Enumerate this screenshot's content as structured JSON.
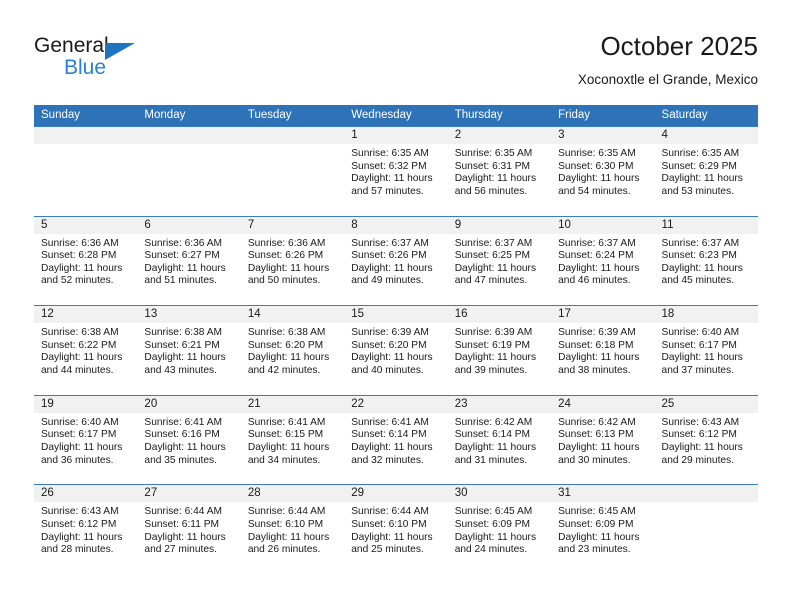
{
  "logo": {
    "text_primary": "General",
    "text_secondary": "Blue",
    "primary_color": "#1a1a1a",
    "secondary_color": "#2980d4",
    "triangle_color": "#1f74bd"
  },
  "header": {
    "title": "October 2025",
    "subtitle": "Xoconoxtle el Grande, Mexico"
  },
  "theme": {
    "header_bar_color": "#2e72b8",
    "date_band_color": "#f1f1f1",
    "week_divider_color": "#3b7cc0",
    "text_color": "#1a1a1a"
  },
  "calendar": {
    "day_headers": [
      "Sunday",
      "Monday",
      "Tuesday",
      "Wednesday",
      "Thursday",
      "Friday",
      "Saturday"
    ],
    "weeks": [
      [
        {
          "date": "",
          "empty": true
        },
        {
          "date": "",
          "empty": true
        },
        {
          "date": "",
          "empty": true
        },
        {
          "date": "1",
          "sunrise": "Sunrise: 6:35 AM",
          "sunset": "Sunset: 6:32 PM",
          "daylight": "Daylight: 11 hours and 57 minutes."
        },
        {
          "date": "2",
          "sunrise": "Sunrise: 6:35 AM",
          "sunset": "Sunset: 6:31 PM",
          "daylight": "Daylight: 11 hours and 56 minutes."
        },
        {
          "date": "3",
          "sunrise": "Sunrise: 6:35 AM",
          "sunset": "Sunset: 6:30 PM",
          "daylight": "Daylight: 11 hours and 54 minutes."
        },
        {
          "date": "4",
          "sunrise": "Sunrise: 6:35 AM",
          "sunset": "Sunset: 6:29 PM",
          "daylight": "Daylight: 11 hours and 53 minutes."
        }
      ],
      [
        {
          "date": "5",
          "sunrise": "Sunrise: 6:36 AM",
          "sunset": "Sunset: 6:28 PM",
          "daylight": "Daylight: 11 hours and 52 minutes."
        },
        {
          "date": "6",
          "sunrise": "Sunrise: 6:36 AM",
          "sunset": "Sunset: 6:27 PM",
          "daylight": "Daylight: 11 hours and 51 minutes."
        },
        {
          "date": "7",
          "sunrise": "Sunrise: 6:36 AM",
          "sunset": "Sunset: 6:26 PM",
          "daylight": "Daylight: 11 hours and 50 minutes."
        },
        {
          "date": "8",
          "sunrise": "Sunrise: 6:37 AM",
          "sunset": "Sunset: 6:26 PM",
          "daylight": "Daylight: 11 hours and 49 minutes."
        },
        {
          "date": "9",
          "sunrise": "Sunrise: 6:37 AM",
          "sunset": "Sunset: 6:25 PM",
          "daylight": "Daylight: 11 hours and 47 minutes."
        },
        {
          "date": "10",
          "sunrise": "Sunrise: 6:37 AM",
          "sunset": "Sunset: 6:24 PM",
          "daylight": "Daylight: 11 hours and 46 minutes."
        },
        {
          "date": "11",
          "sunrise": "Sunrise: 6:37 AM",
          "sunset": "Sunset: 6:23 PM",
          "daylight": "Daylight: 11 hours and 45 minutes."
        }
      ],
      [
        {
          "date": "12",
          "sunrise": "Sunrise: 6:38 AM",
          "sunset": "Sunset: 6:22 PM",
          "daylight": "Daylight: 11 hours and 44 minutes."
        },
        {
          "date": "13",
          "sunrise": "Sunrise: 6:38 AM",
          "sunset": "Sunset: 6:21 PM",
          "daylight": "Daylight: 11 hours and 43 minutes."
        },
        {
          "date": "14",
          "sunrise": "Sunrise: 6:38 AM",
          "sunset": "Sunset: 6:20 PM",
          "daylight": "Daylight: 11 hours and 42 minutes."
        },
        {
          "date": "15",
          "sunrise": "Sunrise: 6:39 AM",
          "sunset": "Sunset: 6:20 PM",
          "daylight": "Daylight: 11 hours and 40 minutes."
        },
        {
          "date": "16",
          "sunrise": "Sunrise: 6:39 AM",
          "sunset": "Sunset: 6:19 PM",
          "daylight": "Daylight: 11 hours and 39 minutes."
        },
        {
          "date": "17",
          "sunrise": "Sunrise: 6:39 AM",
          "sunset": "Sunset: 6:18 PM",
          "daylight": "Daylight: 11 hours and 38 minutes."
        },
        {
          "date": "18",
          "sunrise": "Sunrise: 6:40 AM",
          "sunset": "Sunset: 6:17 PM",
          "daylight": "Daylight: 11 hours and 37 minutes."
        }
      ],
      [
        {
          "date": "19",
          "sunrise": "Sunrise: 6:40 AM",
          "sunset": "Sunset: 6:17 PM",
          "daylight": "Daylight: 11 hours and 36 minutes."
        },
        {
          "date": "20",
          "sunrise": "Sunrise: 6:41 AM",
          "sunset": "Sunset: 6:16 PM",
          "daylight": "Daylight: 11 hours and 35 minutes."
        },
        {
          "date": "21",
          "sunrise": "Sunrise: 6:41 AM",
          "sunset": "Sunset: 6:15 PM",
          "daylight": "Daylight: 11 hours and 34 minutes."
        },
        {
          "date": "22",
          "sunrise": "Sunrise: 6:41 AM",
          "sunset": "Sunset: 6:14 PM",
          "daylight": "Daylight: 11 hours and 32 minutes."
        },
        {
          "date": "23",
          "sunrise": "Sunrise: 6:42 AM",
          "sunset": "Sunset: 6:14 PM",
          "daylight": "Daylight: 11 hours and 31 minutes."
        },
        {
          "date": "24",
          "sunrise": "Sunrise: 6:42 AM",
          "sunset": "Sunset: 6:13 PM",
          "daylight": "Daylight: 11 hours and 30 minutes."
        },
        {
          "date": "25",
          "sunrise": "Sunrise: 6:43 AM",
          "sunset": "Sunset: 6:12 PM",
          "daylight": "Daylight: 11 hours and 29 minutes."
        }
      ],
      [
        {
          "date": "26",
          "sunrise": "Sunrise: 6:43 AM",
          "sunset": "Sunset: 6:12 PM",
          "daylight": "Daylight: 11 hours and 28 minutes."
        },
        {
          "date": "27",
          "sunrise": "Sunrise: 6:44 AM",
          "sunset": "Sunset: 6:11 PM",
          "daylight": "Daylight: 11 hours and 27 minutes."
        },
        {
          "date": "28",
          "sunrise": "Sunrise: 6:44 AM",
          "sunset": "Sunset: 6:10 PM",
          "daylight": "Daylight: 11 hours and 26 minutes."
        },
        {
          "date": "29",
          "sunrise": "Sunrise: 6:44 AM",
          "sunset": "Sunset: 6:10 PM",
          "daylight": "Daylight: 11 hours and 25 minutes."
        },
        {
          "date": "30",
          "sunrise": "Sunrise: 6:45 AM",
          "sunset": "Sunset: 6:09 PM",
          "daylight": "Daylight: 11 hours and 24 minutes."
        },
        {
          "date": "31",
          "sunrise": "Sunrise: 6:45 AM",
          "sunset": "Sunset: 6:09 PM",
          "daylight": "Daylight: 11 hours and 23 minutes."
        },
        {
          "date": "",
          "empty": true
        }
      ]
    ]
  }
}
